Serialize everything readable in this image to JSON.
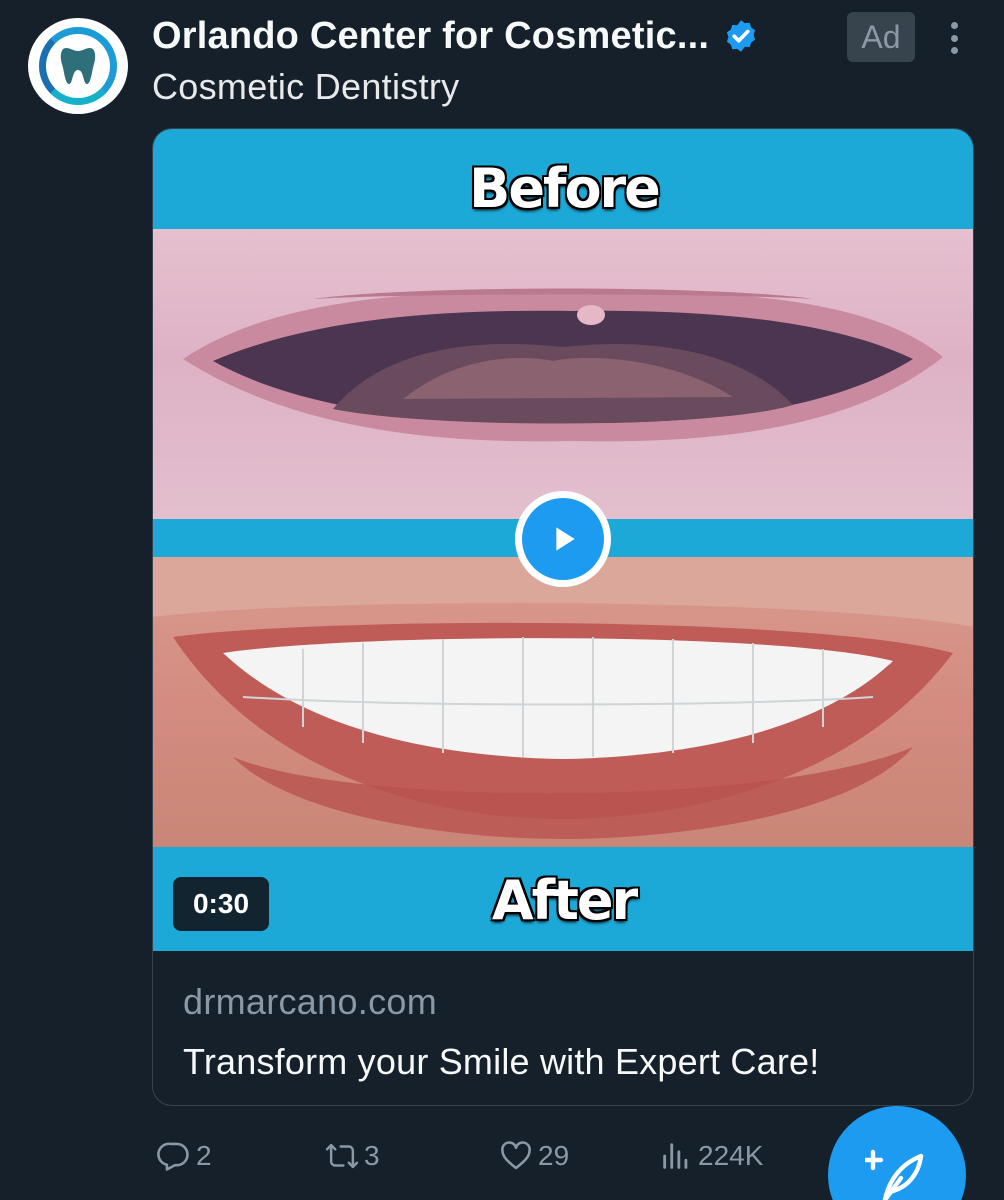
{
  "post": {
    "display_name": "Orlando Center for Cosmetic...",
    "subtitle": "Cosmetic Dentistry",
    "ad_label": "Ad",
    "verified": true
  },
  "media": {
    "before_label": "Before",
    "after_label": "After",
    "duration": "0:30"
  },
  "link_card": {
    "domain": "drmarcano.com",
    "title": "Transform your Smile with Expert Care!"
  },
  "actions": {
    "replies": "2",
    "reposts": "3",
    "likes": "29",
    "views": "224K"
  },
  "colors": {
    "background": "#15202b",
    "accent": "#1d9bf0",
    "muted": "#8b98a5",
    "banner": "#1da9d8"
  }
}
